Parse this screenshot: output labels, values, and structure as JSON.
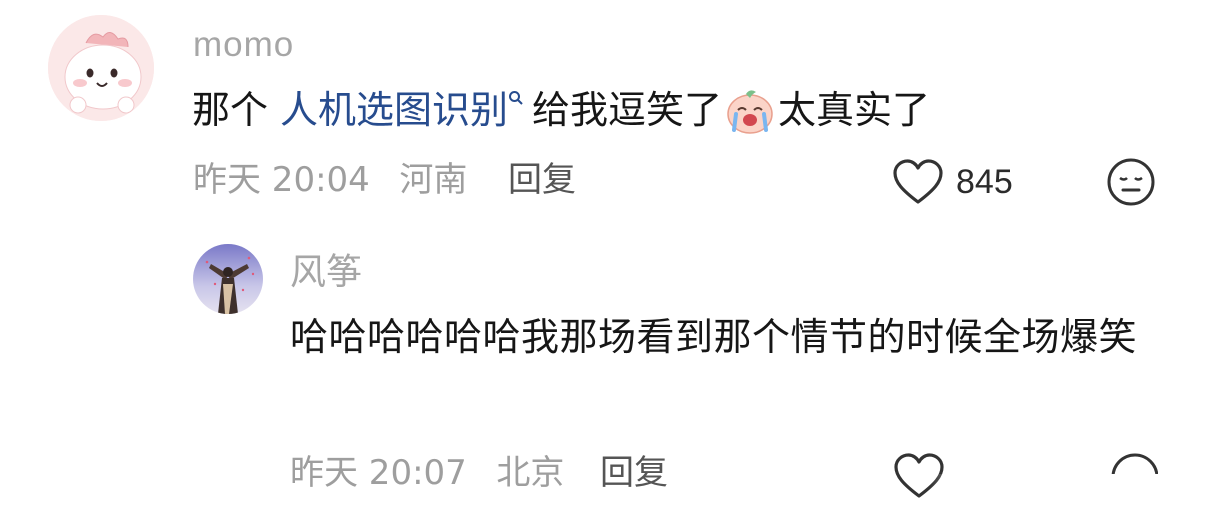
{
  "comment": {
    "username": "momo",
    "text_prefix": "那个",
    "link_text": "人机选图识别",
    "text_mid": "给我逗笑了",
    "text_suffix": "太真实了",
    "time": "昨天 20:04",
    "location": "河南",
    "reply_label": "回复",
    "like_count": "845"
  },
  "reply_comment": {
    "username": "风筝",
    "text": "哈哈哈哈哈哈我那场看到那个情节的时候全场爆笑",
    "time": "昨天 20:07",
    "location": "北京",
    "reply_label": "回复"
  },
  "icons": {
    "search": "search-icon",
    "emoji": "crying-laughing-peach-emoji",
    "like": "heart-icon",
    "react": "emoji-react-icon"
  }
}
